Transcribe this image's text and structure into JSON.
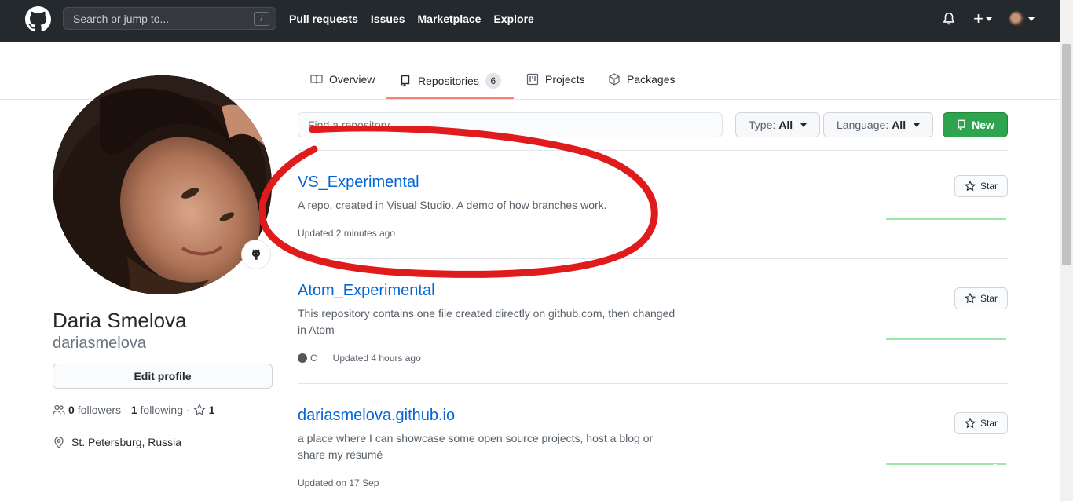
{
  "header": {
    "search_placeholder": "Search or jump to...",
    "search_shortcut": "/",
    "nav": [
      "Pull requests",
      "Issues",
      "Marketplace",
      "Explore"
    ],
    "plus_label": "+"
  },
  "tabs": [
    {
      "label": "Overview"
    },
    {
      "label": "Repositories",
      "count": "6"
    },
    {
      "label": "Projects"
    },
    {
      "label": "Packages"
    }
  ],
  "profile": {
    "full_name": "Daria Smelova",
    "username": "dariasmelova",
    "edit_label": "Edit profile",
    "followers_count": "0",
    "followers_label": "followers",
    "following_count": "1",
    "following_label": "following",
    "stars_count": "1",
    "location": "St. Petersburg, Russia"
  },
  "filters": {
    "find_placeholder": "Find a repository...",
    "type_label": "Type:",
    "type_value": "All",
    "language_label": "Language:",
    "language_value": "All",
    "new_label": "New"
  },
  "repos": [
    {
      "name": "VS_Experimental",
      "description": "A repo, created in Visual Studio. A demo of how branches work.",
      "language": "",
      "updated": "Updated 2 minutes ago",
      "star_label": "Star"
    },
    {
      "name": "Atom_Experimental",
      "description": "This repository contains one file created directly on github.com, then changed in Atom",
      "language": "C",
      "updated": "Updated 4 hours ago",
      "star_label": "Star"
    },
    {
      "name": "dariasmelova.github.io",
      "description": "a place where I can showcase some open source projects, host a blog or share my résumé",
      "language": "",
      "updated": "Updated on 17 Sep",
      "star_label": "Star"
    }
  ],
  "colors": {
    "header_bg": "#24292e",
    "link": "#0366d6",
    "new_button": "#2ea44f",
    "annotation": "#e01b1b",
    "tab_active": "#f9826c"
  }
}
